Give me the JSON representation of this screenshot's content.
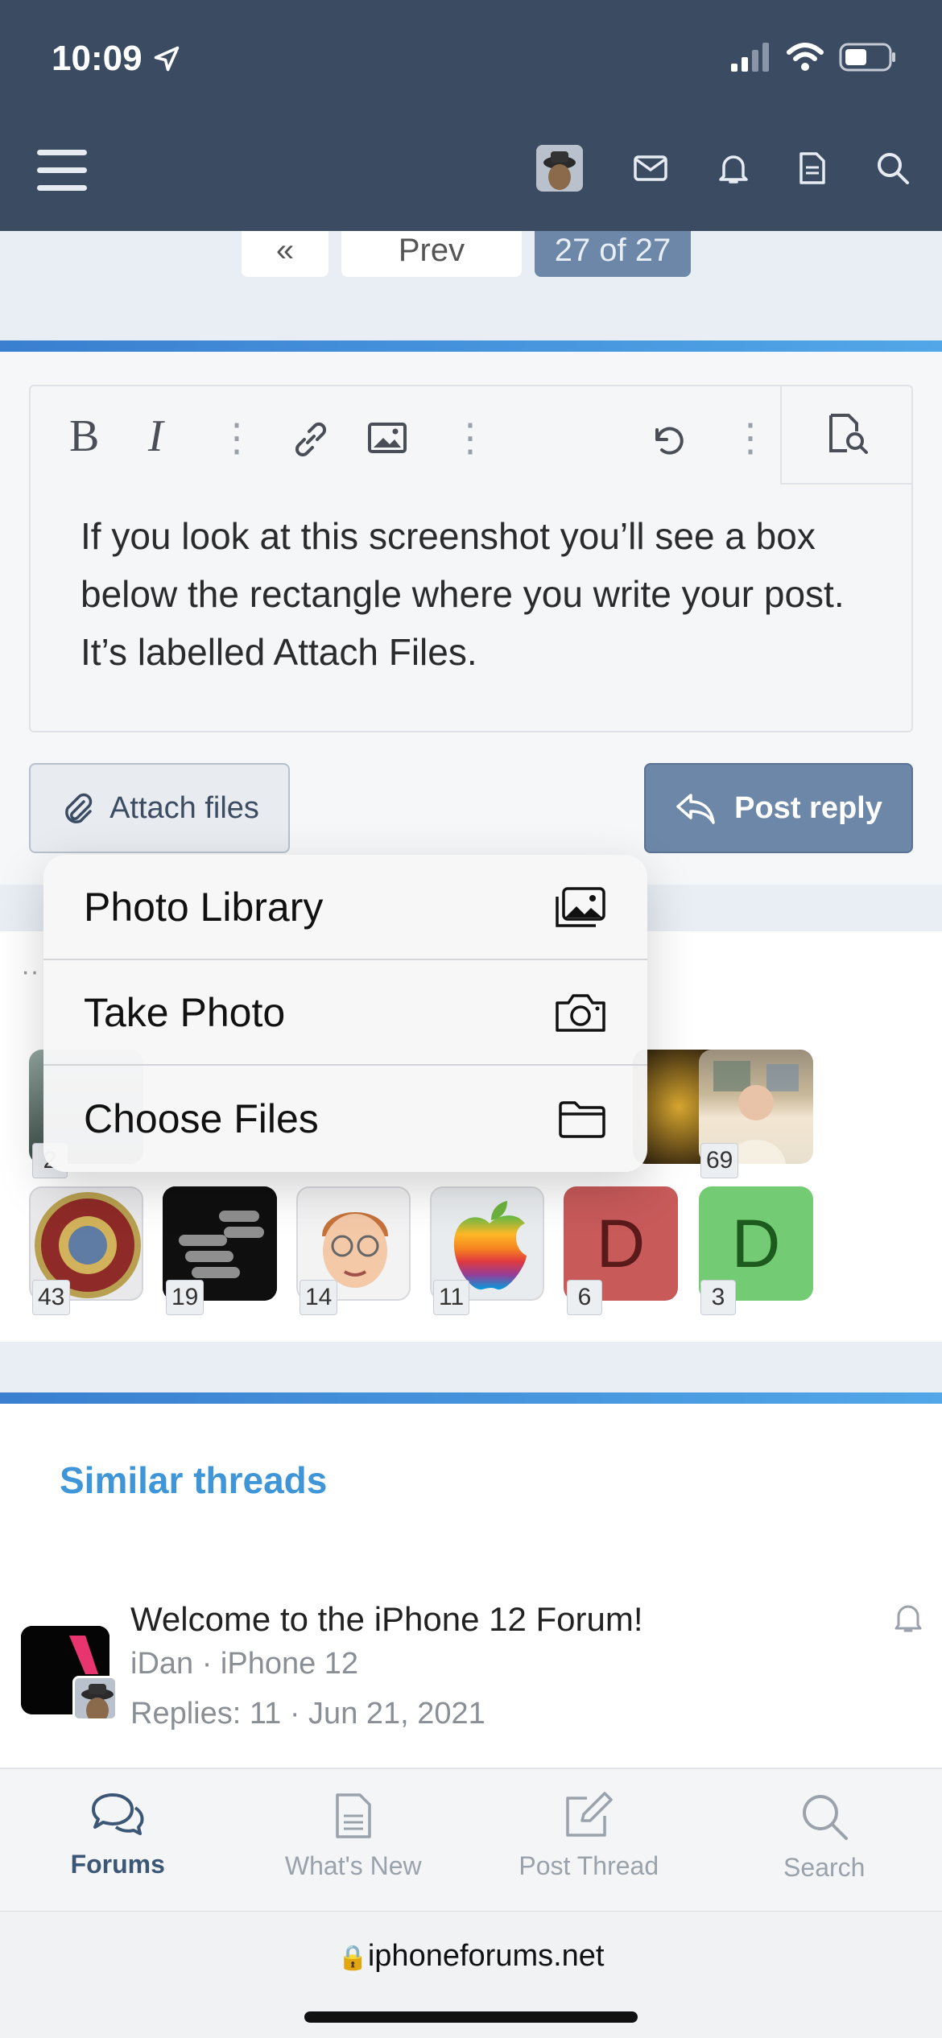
{
  "status_bar": {
    "time": "10:09"
  },
  "pager": {
    "first": "«",
    "prev": "Prev",
    "current": "27 of 27"
  },
  "editor": {
    "toolbar": [
      "B",
      "I",
      "⋮",
      "link",
      "image",
      "⋮",
      "undo",
      "⋮",
      "preview"
    ],
    "text": "If you look at this screenshot you’ll see a box below the rectangle where you write your post. It’s labelled Attach Files."
  },
  "actions": {
    "attach_label": "Attach files",
    "post_label": "Post reply"
  },
  "attach_menu": [
    {
      "label": "Photo Library",
      "icon": "photo-library-icon"
    },
    {
      "label": "Take Photo",
      "icon": "camera-icon"
    },
    {
      "label": "Choose Files",
      "icon": "folder-icon"
    }
  ],
  "reactions": {
    "row1_counts": [
      "2",
      "69"
    ],
    "row2": [
      {
        "count": "43",
        "kind": "marine-seal",
        "color": "#9b2f2c"
      },
      {
        "count": "19",
        "kind": "dark-object",
        "color": "#222222"
      },
      {
        "count": "14",
        "kind": "memoji",
        "color": "#f1e2d3"
      },
      {
        "count": "11",
        "kind": "apple-logo",
        "color": "#e0e6ec"
      },
      {
        "count": "6",
        "letter": "D",
        "color": "#c85a5a"
      },
      {
        "count": "3",
        "letter": "D",
        "color": "#73cc73"
      }
    ]
  },
  "similar": {
    "title": "Similar threads",
    "thread": {
      "title": "Welcome to the iPhone 12 Forum!",
      "author_line": "iDan · iPhone 12",
      "stats_line": "Replies: 11 · Jun 21, 2021"
    }
  },
  "bottom_nav": [
    {
      "label": "Forums",
      "active": true
    },
    {
      "label": "What's New",
      "active": false
    },
    {
      "label": "Post Thread",
      "active": false
    },
    {
      "label": "Search",
      "active": false
    }
  ],
  "browser": {
    "url": "iphoneforums.net"
  }
}
